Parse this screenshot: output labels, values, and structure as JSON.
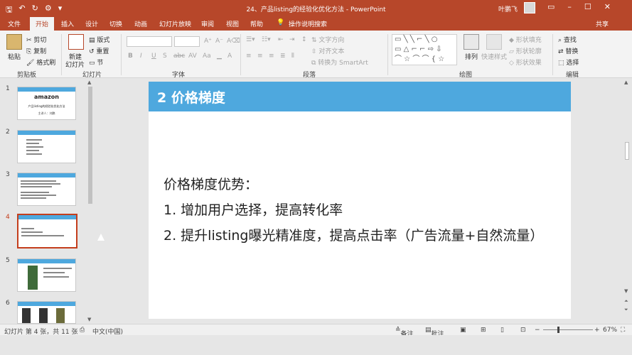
{
  "titlebar": {
    "title": "24、产品listing的经验化优化方法 - PowerPoint",
    "user": "叶鹏飞",
    "share": "共享"
  },
  "tabs": [
    "文件",
    "开始",
    "插入",
    "设计",
    "切换",
    "动画",
    "幻灯片放映",
    "审阅",
    "视图",
    "帮助"
  ],
  "tell_me": "操作说明搜索",
  "ribbon": {
    "clipboard": {
      "label": "剪贴板",
      "paste": "粘贴",
      "cut": "剪切",
      "copy": "复制",
      "format_painter": "格式刷"
    },
    "slides": {
      "label": "幻灯片",
      "new_slide_1": "新建",
      "new_slide_2": "幻灯片",
      "layout": "版式",
      "reset": "重置",
      "section": "节"
    },
    "font": {
      "label": "字体"
    },
    "paragraph": {
      "label": "段落",
      "text_direction": "文字方向",
      "align_text": "对齐文本",
      "smartart": "转换为 SmartArt"
    },
    "drawing": {
      "label": "绘图",
      "arrange": "排列",
      "quick_styles": "快速样式",
      "shape_fill": "形状填充",
      "shape_outline": "形状轮廓",
      "shape_effects": "形状效果"
    },
    "editing": {
      "label": "编辑",
      "find": "查找",
      "replace": "替换",
      "select": "选择"
    }
  },
  "thumbnails": [
    {
      "num": "1",
      "title": "amazon",
      "subtitle": "产品listing的经验化优化方法",
      "author": "主讲人：刘鹏"
    },
    {
      "num": "2"
    },
    {
      "num": "3"
    },
    {
      "num": "4"
    },
    {
      "num": "5"
    },
    {
      "num": "6"
    }
  ],
  "slide": {
    "title": "2 价格梯度",
    "heading": "价格梯度优势：",
    "point1": "1. 增加用户选择，提高转化率",
    "point2": "2. 提升listing曝光精准度，提高点击率（广告流量+自然流量）"
  },
  "status": {
    "slide_info": "幻灯片 第 4 张，共 11 张",
    "language": "中文(中国)",
    "notes": "备注",
    "comments": "批注",
    "zoom": "67%"
  },
  "colors": {
    "accent": "#b7472a",
    "slide_header": "#4ea8de",
    "active_thumb": "#c43e1c"
  }
}
